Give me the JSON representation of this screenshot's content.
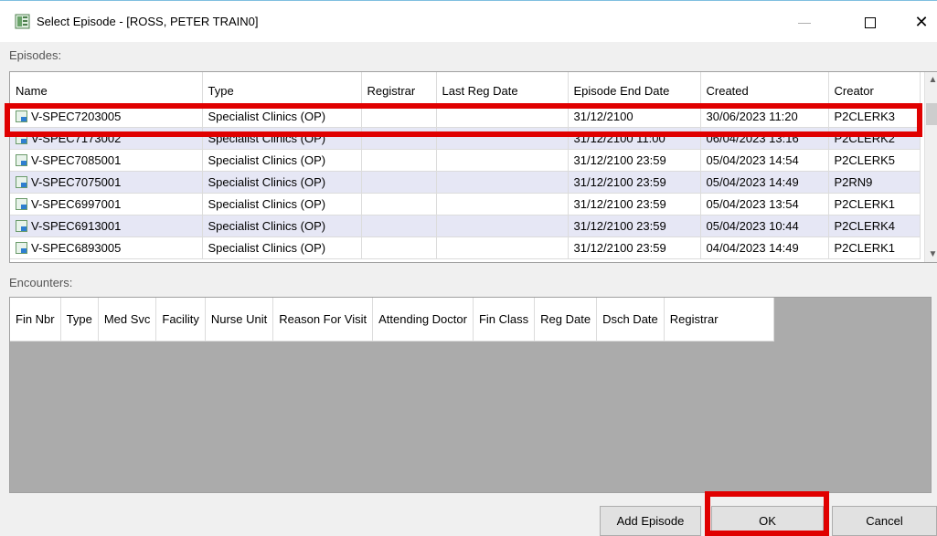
{
  "window": {
    "title": "Select Episode - [ROSS, PETER TRAIN0]",
    "minimize_glyph": "—",
    "close_glyph": "✕"
  },
  "episodes": {
    "label": "Episodes:",
    "columns": [
      "Name",
      "Type",
      "Registrar",
      "Last Reg Date",
      "Episode End Date",
      "Created",
      "Creator"
    ],
    "rows": [
      {
        "name": "V-SPEC7203005",
        "type": "Specialist Clinics (OP)",
        "registrar": "",
        "last_reg_date": "",
        "end_date": "31/12/2100",
        "created": "30/06/2023 11:20",
        "creator": "P2CLERK3"
      },
      {
        "name": "V-SPEC7173002",
        "type": "Specialist Clinics (OP)",
        "registrar": "",
        "last_reg_date": "",
        "end_date": "31/12/2100 11:00",
        "created": "06/04/2023 13:16",
        "creator": "P2CLERK2"
      },
      {
        "name": "V-SPEC7085001",
        "type": "Specialist Clinics (OP)",
        "registrar": "",
        "last_reg_date": "",
        "end_date": "31/12/2100 23:59",
        "created": "05/04/2023 14:54",
        "creator": "P2CLERK5"
      },
      {
        "name": "V-SPEC7075001",
        "type": "Specialist Clinics (OP)",
        "registrar": "",
        "last_reg_date": "",
        "end_date": "31/12/2100 23:59",
        "created": "05/04/2023 14:49",
        "creator": "P2RN9"
      },
      {
        "name": "V-SPEC6997001",
        "type": "Specialist Clinics (OP)",
        "registrar": "",
        "last_reg_date": "",
        "end_date": "31/12/2100 23:59",
        "created": "05/04/2023 13:54",
        "creator": "P2CLERK1"
      },
      {
        "name": "V-SPEC6913001",
        "type": "Specialist Clinics (OP)",
        "registrar": "",
        "last_reg_date": "",
        "end_date": "31/12/2100 23:59",
        "created": "05/04/2023 10:44",
        "creator": "P2CLERK4"
      },
      {
        "name": "V-SPEC6893005",
        "type": "Specialist Clinics (OP)",
        "registrar": "",
        "last_reg_date": "",
        "end_date": "31/12/2100 23:59",
        "created": "04/04/2023 14:49",
        "creator": "P2CLERK1"
      }
    ]
  },
  "encounters": {
    "label": "Encounters:",
    "columns": [
      "Fin Nbr",
      "Type",
      "Med Svc",
      "Facility",
      "Nurse Unit",
      "Reason For Visit",
      "Attending Doctor",
      "Fin Class",
      "Reg Date",
      "Dsch Date",
      "Registrar"
    ]
  },
  "buttons": {
    "add_episode": "Add Episode",
    "ok": "OK",
    "cancel": "Cancel"
  },
  "colors": {
    "highlight": "#e00000",
    "alt_row": "#e6e7f5"
  }
}
